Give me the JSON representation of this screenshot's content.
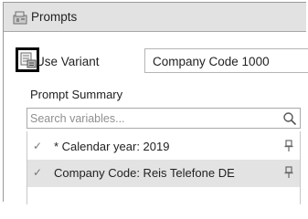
{
  "window": {
    "title": "Prompts",
    "title_icon": "prompts-icon"
  },
  "variant": {
    "icon": "variant-icon",
    "label": "Use Variant",
    "value": "Company Code 1000"
  },
  "summary": {
    "label": "Prompt Summary",
    "search": {
      "placeholder": "Search variables...",
      "icon": "search-icon"
    },
    "items": [
      {
        "check": "✓",
        "text": "* Calendar year: 2019",
        "icon": "pin-icon"
      },
      {
        "check": "✓",
        "text": "Company Code: Reis Telefone DE",
        "icon": "pin-icon"
      }
    ]
  },
  "colors": {
    "titlebar": "#e2e2e2",
    "highlight_frame": "#000000",
    "selected_row": "#e3e3e3"
  }
}
